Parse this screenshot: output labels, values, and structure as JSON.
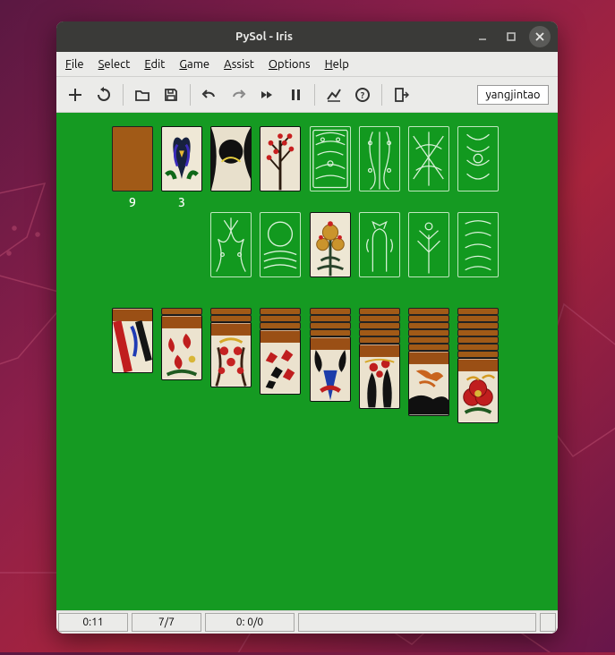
{
  "window": {
    "title": "PySol - Iris"
  },
  "menu": {
    "file": "File",
    "select": "Select",
    "edit": "Edit",
    "game": "Game",
    "assist": "Assist",
    "options": "Options",
    "help": "Help"
  },
  "toolbar": {
    "new": "new-game",
    "restart": "restart",
    "open": "open",
    "save": "save",
    "undo": "undo",
    "redo": "redo",
    "autodrop": "auto-drop",
    "pause": "pause",
    "stats": "statistics",
    "rules": "rules",
    "quit": "quit",
    "user": "yangjintao"
  },
  "stock": {
    "count_label": "9"
  },
  "waste": {
    "count_label": "3"
  },
  "status": {
    "time": "0:11",
    "moves": "7/7",
    "score": "0: 0/0"
  },
  "foundations_top": [
    {
      "month": "may",
      "name": "iris-tanzaku"
    },
    {
      "month": "aug",
      "name": "moon-plain"
    },
    {
      "month": "feb",
      "name": "plum-plain"
    }
  ],
  "foundations_bottom_face": [
    {
      "month": "sep-chrys"
    }
  ],
  "tableau": [
    {
      "hidden": 0,
      "face": "nov-lightning"
    },
    {
      "hidden": 1,
      "face": "jan-pine-crane"
    },
    {
      "hidden": 2,
      "face": "feb-plum-warbler"
    },
    {
      "hidden": 3,
      "face": "oct-maple"
    },
    {
      "hidden": 4,
      "face": "may-iris-bridge"
    },
    {
      "hidden": 5,
      "face": "jan-pine"
    },
    {
      "hidden": 6,
      "face": "nov-swallow"
    },
    {
      "hidden": 7,
      "face": "dec-peony"
    }
  ]
}
